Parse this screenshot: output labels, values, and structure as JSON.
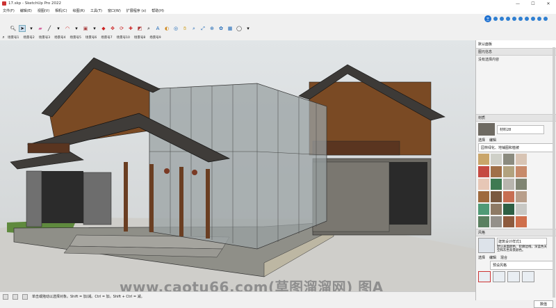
{
  "window": {
    "title": "17.skp - SketchUp Pro 2022",
    "minimize": "—",
    "maximize": "☐",
    "close": "✕"
  },
  "menu": [
    "文件(F)",
    "编辑(E)",
    "视图(V)",
    "相机(C)",
    "绘图(R)",
    "工具(T)",
    "窗口(W)",
    "扩展程序 (x)",
    "帮助(H)"
  ],
  "toolbar_icons": [
    "search-icon",
    "select-icon",
    "dropdown-icon",
    "eraser-icon",
    "line-icon",
    "dropdown-icon",
    "arc-icon",
    "dropdown-icon",
    "rectangle-icon",
    "dropdown-icon",
    "pushpull-icon",
    "move-icon",
    "rotate-icon",
    "scale-icon",
    "offset-icon",
    "tape-icon",
    "text-icon",
    "paint-icon",
    "orbit-icon",
    "pan-icon",
    "zoom-icon",
    "zoom-extents-icon",
    "warehouse-icon",
    "extension-icon",
    "layout-icon",
    "profile-icon",
    "dropdown-icon"
  ],
  "scenes": [
    "场景号1",
    "场景号2",
    "场景号3",
    "场景号4",
    "场景号5",
    "场景号6",
    "场景号7",
    "场景号10",
    "场景号8",
    "场景号9"
  ],
  "tray": {
    "title": "默认面板"
  },
  "entity_info": {
    "header": "图元信息",
    "value": "没有选择内容"
  },
  "materials": {
    "header": "材质",
    "name": "材料28",
    "tabs": [
      "选择",
      "编辑"
    ],
    "library": "园林绿化、地铺图和植被",
    "swatch_colors": [
      "#c9a56a",
      "#cfd0c8",
      "#8b8b7f",
      "#d8c4b4",
      "#c54a42",
      "#a07048",
      "#b2a27e",
      "#c78a6a",
      "#e7c7b6",
      "#3f7a52",
      "#b8b5ae",
      "#7f8472",
      "#9e6a3d",
      "#7a5940",
      "#c76e52",
      "#b89e8a",
      "#4f9a76",
      "#8e7a65",
      "#2e5f44",
      "#c8c8c4",
      "#5a8060",
      "#94908a",
      "#8d5a3e",
      "#cf6f4c"
    ]
  },
  "styles": {
    "header": "风格",
    "name": "建筑设计样式1",
    "description": "默认表面颜色、轮廓边线，深蓝色天空和灰色背景颜色。",
    "tabs": [
      "选择",
      "编辑",
      "混合"
    ],
    "library": "预设风格"
  },
  "default_tray_button": "数值",
  "status": {
    "text": "单击或拖动以选择对象。Shift = 加/减。Ctrl = 加。Shift + Ctrl = 减。"
  },
  "watermark": "www.caotu66.com(草图溜溜网) 图A"
}
